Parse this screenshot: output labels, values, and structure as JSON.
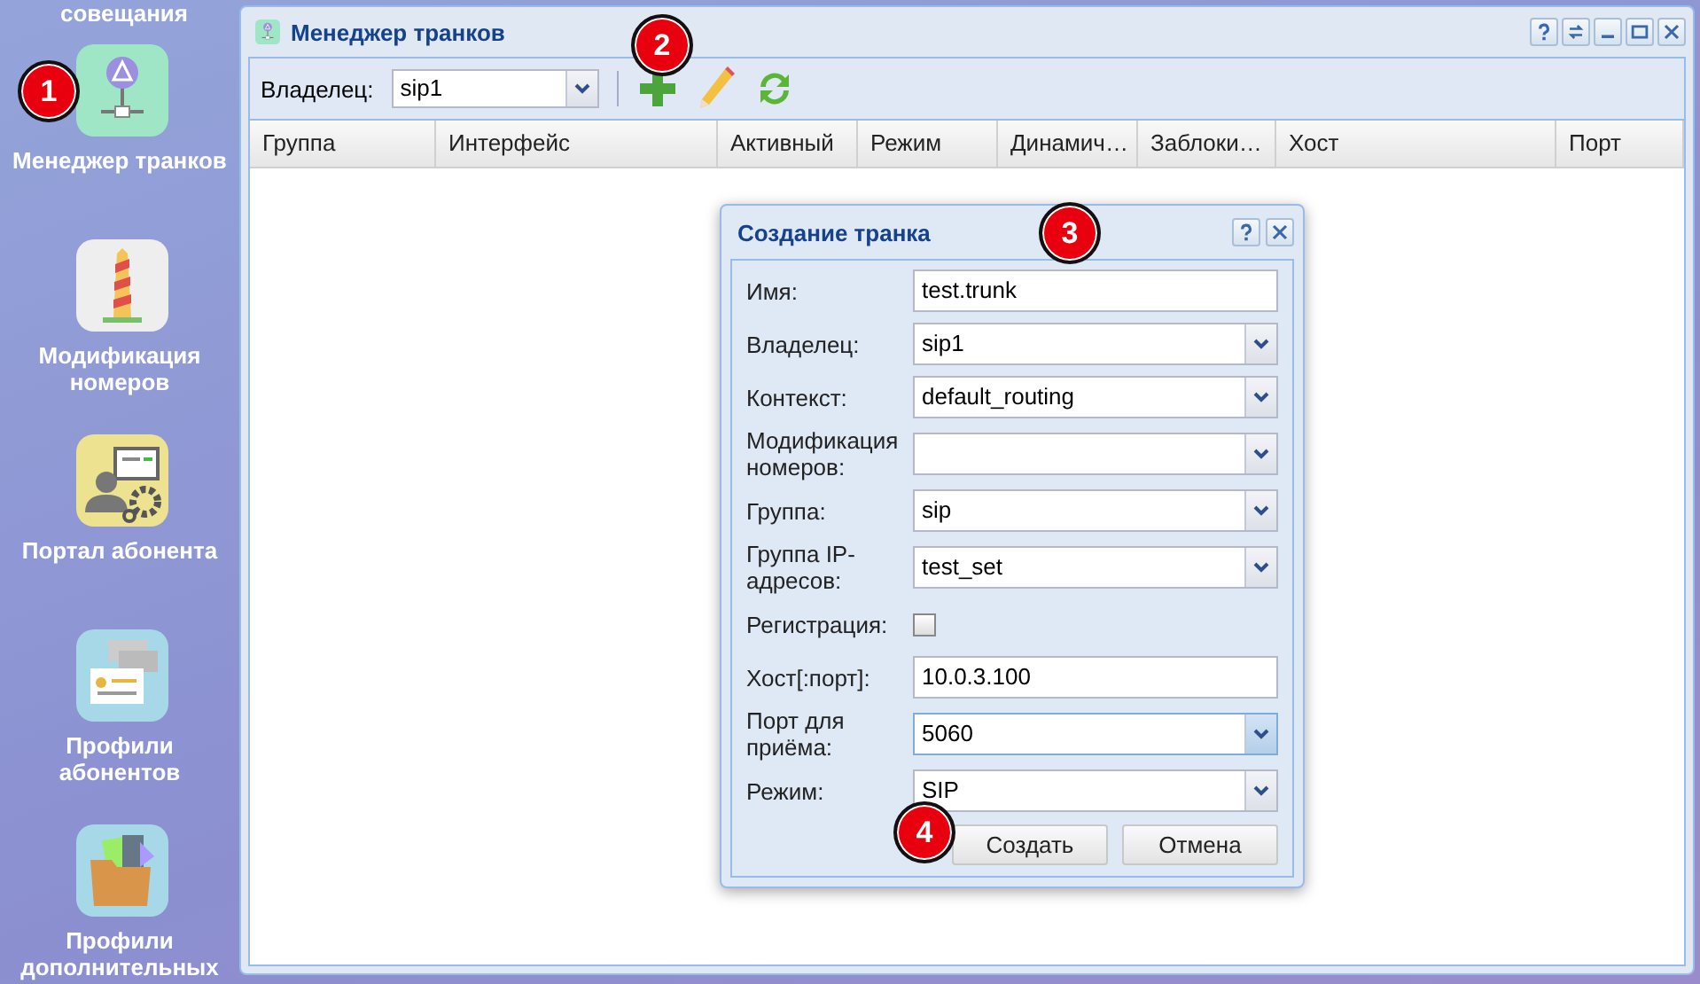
{
  "desktop": {
    "top_label": "совещания",
    "icons": [
      {
        "label": "Менеджер транков",
        "kind": "trunk"
      },
      {
        "label": "Модификация номеров",
        "kind": "tower"
      },
      {
        "label": "Портал абонента",
        "kind": "portal"
      },
      {
        "label": "Профили абонентов",
        "kind": "cards"
      },
      {
        "label": "Профили дополнительных",
        "kind": "folder"
      }
    ]
  },
  "window": {
    "title": "Менеджер транков",
    "toolbar": {
      "owner_label": "Владелец:",
      "owner_value": "sip1"
    },
    "columns": [
      "Группа",
      "Интерфейс",
      "Активный",
      "Режим",
      "Динамич…",
      "Заблоки…",
      "Хост",
      "Порт"
    ]
  },
  "dialog": {
    "title": "Создание транка",
    "fields": [
      {
        "kind": "text",
        "label": "Имя:",
        "value": "test.trunk"
      },
      {
        "kind": "combo",
        "label": "Владелец:",
        "value": "sip1",
        "focused": false
      },
      {
        "kind": "combo",
        "label": "Контекст:",
        "value": "default_routing",
        "focused": false
      },
      {
        "kind": "combo",
        "label": "Модификация номеров:",
        "focused": false
      },
      {
        "kind": "combo",
        "label": "Группа:",
        "value": "sip",
        "focused": false
      },
      {
        "kind": "combo",
        "label": "Группа IP-адресов:",
        "value": "test_set",
        "focused": false
      },
      {
        "kind": "checkbox",
        "label": "Регистрация:",
        "checked": false
      },
      {
        "kind": "text",
        "label": "Хост[:порт]:",
        "value": "10.0.3.100"
      },
      {
        "kind": "combo",
        "label": "Порт для приёма:",
        "value": "5060",
        "focused": true
      },
      {
        "kind": "combo",
        "label": "Режим:",
        "value": "SIP",
        "focused": false
      }
    ],
    "buttons": [
      "Создать",
      "Отмена"
    ]
  },
  "badges": [
    "1",
    "2",
    "3",
    "4"
  ]
}
